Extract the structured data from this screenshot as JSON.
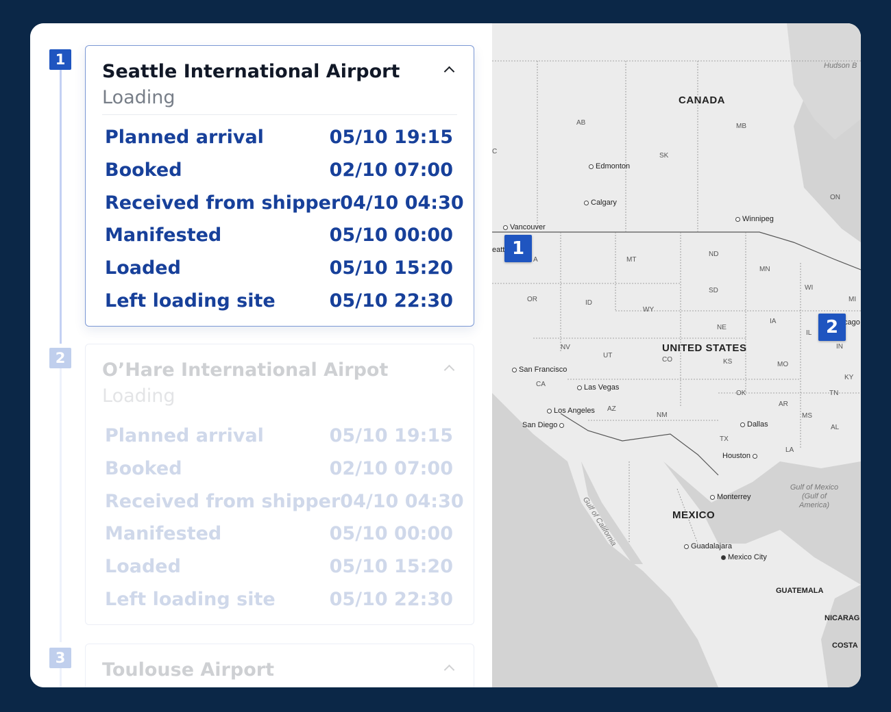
{
  "timeline": {
    "stops": [
      {
        "number": "1",
        "name": "Seattle International Airport",
        "status": "Loading",
        "events": [
          {
            "label": "Planned arrival",
            "time": "05/10 19:15"
          },
          {
            "label": "Booked",
            "time": "02/10 07:00"
          },
          {
            "label": "Received from shipper",
            "time": "04/10 04:30"
          },
          {
            "label": "Manifested",
            "time": "05/10 00:00"
          },
          {
            "label": "Loaded",
            "time": "05/10 15:20"
          },
          {
            "label": "Left loading site",
            "time": "05/10 22:30"
          }
        ]
      },
      {
        "number": "2",
        "name": "O’Hare International Airpot",
        "status": "Loading",
        "events": [
          {
            "label": "Planned arrival",
            "time": "05/10 19:15"
          },
          {
            "label": "Booked",
            "time": "02/10 07:00"
          },
          {
            "label": "Received from shipper",
            "time": "04/10 04:30"
          },
          {
            "label": "Manifested",
            "time": "05/10 00:00"
          },
          {
            "label": "Loaded",
            "time": "05/10 15:20"
          },
          {
            "label": "Left loading site",
            "time": "05/10 22:30"
          }
        ]
      },
      {
        "number": "3",
        "name": "Toulouse Airport"
      }
    ]
  },
  "map": {
    "markers": [
      "1",
      "2"
    ],
    "countries": [
      "CANADA",
      "UNITED STATES",
      "MEXICO",
      "GUATEMALA",
      "NICARAG",
      "COSTA"
    ],
    "regions": [
      "AB",
      "MB",
      "SK",
      "ON",
      "ND",
      "MT",
      "MN",
      "WI",
      "MI",
      "OR",
      "ID",
      "WY",
      "SD",
      "NE",
      "IA",
      "IL",
      "IN",
      "NV",
      "UT",
      "CO",
      "KS",
      "MO",
      "KY",
      "CA",
      "OK",
      "TN",
      "AZ",
      "NM",
      "AR",
      "MS",
      "AL",
      "TX",
      "LA",
      "A",
      "C"
    ],
    "cities": [
      "Edmonton",
      "Calgary",
      "Vancouver",
      "Winnipeg",
      "San Francisco",
      "Las Vegas",
      "Los Angeles",
      "San Diego",
      "Dallas",
      "Houston",
      "Monterrey",
      "Guadalajara",
      "Mexico City",
      "eatt",
      "cago"
    ],
    "water": [
      "Hudson B",
      "Gulf of California",
      "Gulf of Mexico (Gulf of America)"
    ]
  }
}
